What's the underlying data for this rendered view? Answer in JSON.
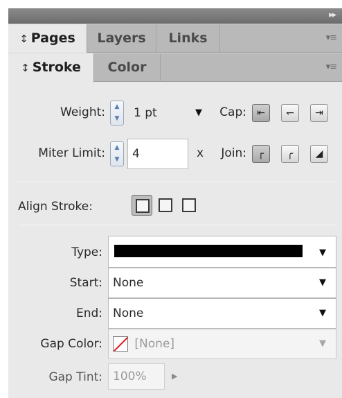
{
  "title_bar": {
    "collapse_icon": "double-chevron-right"
  },
  "tabs_row1": [
    {
      "label": "Pages",
      "active": true,
      "arrows": "↕"
    },
    {
      "label": "Layers",
      "active": false
    },
    {
      "label": "Links",
      "active": false
    }
  ],
  "tabs_row2": [
    {
      "label": "Stroke",
      "active": true,
      "arrows": "↕"
    },
    {
      "label": "Color",
      "active": false
    }
  ],
  "menu_icon_glyph": "▾≡",
  "stroke": {
    "weight_label": "Weight:",
    "weight_value": "1 pt",
    "cap_label": "Cap:",
    "miter_label": "Miter Limit:",
    "miter_value": "4",
    "miter_unit": "x",
    "join_label": "Join:",
    "align_label": "Align Stroke:",
    "type_label": "Type:",
    "type_color": "#000000",
    "start_label": "Start:",
    "start_value": "None",
    "end_label": "End:",
    "end_value": "None",
    "gap_color_label": "Gap Color:",
    "gap_color_value": "[None]",
    "gap_tint_label": "Gap Tint:",
    "gap_tint_value": "100%"
  }
}
